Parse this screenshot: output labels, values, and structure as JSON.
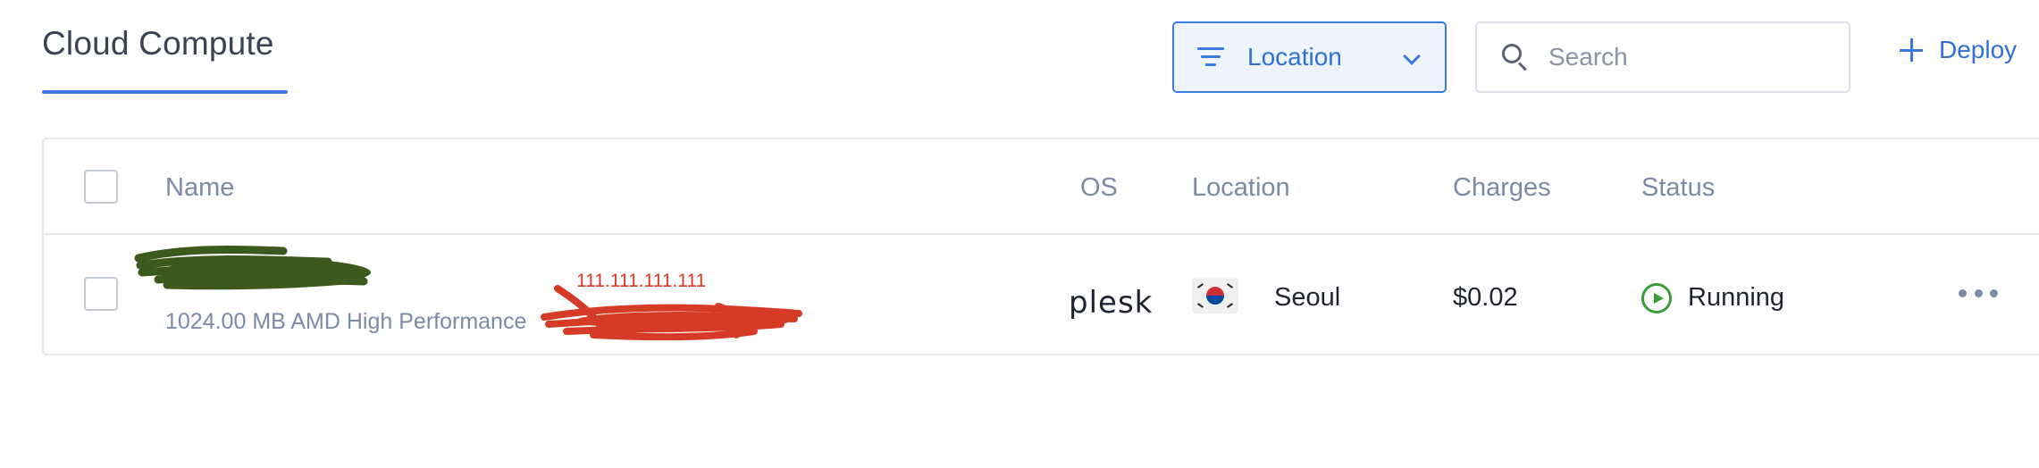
{
  "page": {
    "title": "Cloud Compute"
  },
  "toolbar": {
    "location_label": "Location",
    "search_placeholder": "Search",
    "deploy_label": "Deploy"
  },
  "table": {
    "columns": {
      "name": "Name",
      "os": "OS",
      "location": "Location",
      "charges": "Charges",
      "status": "Status"
    },
    "rows": [
      {
        "plan": "1024.00 MB AMD High Performance",
        "ip_annotation": "111.111.111.111",
        "os": "plesk",
        "location": "Seoul",
        "charges": "$0.02",
        "status": "Running"
      }
    ]
  },
  "colors": {
    "accent": "#3b7ae0",
    "status_running": "#3a9c3a",
    "redaction_green": "#3d5a1e",
    "redaction_red": "#d63b27"
  },
  "icons": {
    "filter": "filter-icon",
    "chevron": "chevron-down-icon",
    "search": "search-icon",
    "deploy": "plus-icon",
    "flag": "south-korea-flag-icon",
    "status": "play-circle-icon",
    "more": "more-horizontal-icon"
  }
}
